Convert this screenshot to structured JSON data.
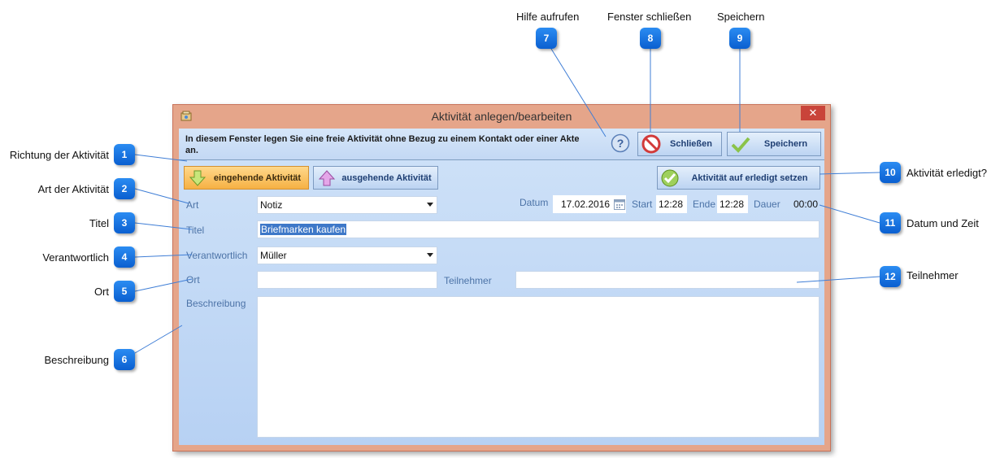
{
  "window": {
    "title": "Aktivität anlegen/bearbeiten",
    "close_symbol": "✕",
    "info_text": "In diesem Fenster legen Sie eine freie Aktivität ohne Bezug zu einem Kontakt oder einer Akte an."
  },
  "toolbar": {
    "close_label": "Schließen",
    "save_label": "Speichern",
    "help_symbol": "?"
  },
  "direction": {
    "incoming_label": "eingehende Aktivität",
    "outgoing_label": "ausgehende Aktivität"
  },
  "mark_done_label": "Aktivität auf erledigt setzen",
  "form": {
    "art_label": "Art",
    "art_value": "Notiz",
    "titel_label": "Titel",
    "titel_value": "Briefmarken kaufen",
    "verantwortlich_label": "Verantwortlich",
    "verantwortlich_value": "Müller",
    "ort_label": "Ort",
    "ort_value": "",
    "teilnehmer_label": "Teilnehmer",
    "teilnehmer_value": "",
    "beschreibung_label": "Beschreibung",
    "beschreibung_value": "",
    "datum_label": "Datum",
    "datum_value": "17.02.2016",
    "start_label": "Start",
    "start_value": "12:28",
    "ende_label": "Ende",
    "ende_value": "12:28",
    "dauer_label": "Dauer",
    "dauer_value": "00:00"
  },
  "callouts": [
    {
      "num": "1",
      "label": "Richtung der Aktivität"
    },
    {
      "num": "2",
      "label": "Art der Aktivität"
    },
    {
      "num": "3",
      "label": "Titel"
    },
    {
      "num": "4",
      "label": "Verantwortlich"
    },
    {
      "num": "5",
      "label": "Ort"
    },
    {
      "num": "6",
      "label": "Beschreibung"
    },
    {
      "num": "7",
      "label": "Hilfe aufrufen"
    },
    {
      "num": "8",
      "label": "Fenster schließen"
    },
    {
      "num": "9",
      "label": "Speichern"
    },
    {
      "num": "10",
      "label": "Aktivität erledigt?"
    },
    {
      "num": "11",
      "label": "Datum und Zeit"
    },
    {
      "num": "12",
      "label": "Teilnehmer"
    }
  ],
  "icons": {
    "app": "app-icon",
    "help": "help-icon",
    "close": "no-entry-icon",
    "save": "checkmark-icon",
    "incoming": "arrow-down-icon",
    "outgoing": "arrow-up-icon",
    "done": "check-circle-icon",
    "calendar": "calendar-icon"
  },
  "colors": {
    "window_frame": "#e5a58a",
    "client_bg": "#c3d8f4",
    "callout_badge": "#1a76e0",
    "label_text": "#4c73a7",
    "incoming_button": "#f6b144"
  }
}
